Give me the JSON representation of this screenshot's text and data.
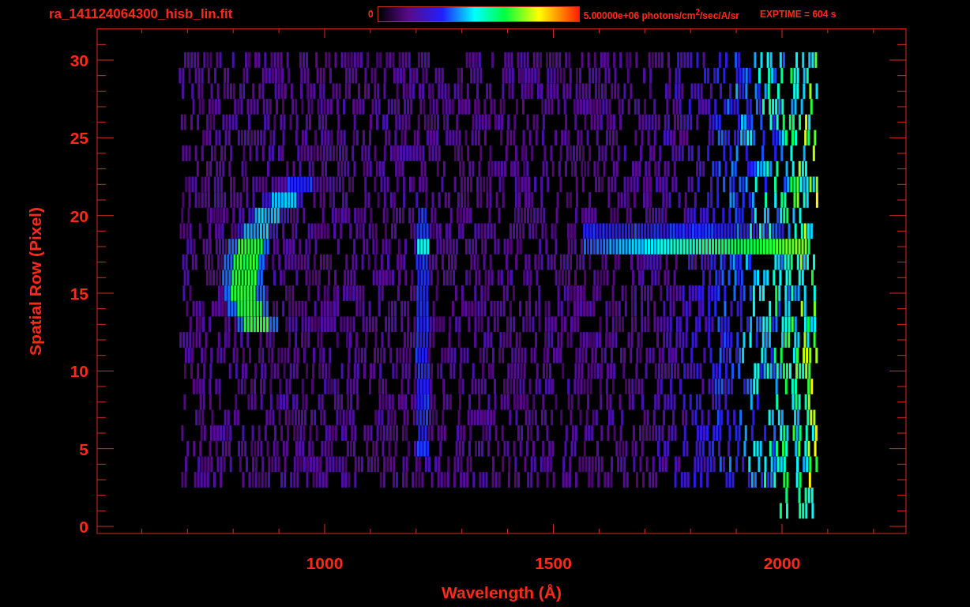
{
  "title": "ra_141124064300_hisb_lin.fit",
  "colorbar": {
    "min_label": "0",
    "max_label": "5.00000e+06 photons/cm$^{2}$/sec/A/sr"
  },
  "exposure": "EXPTIME = 604 s",
  "plot": {
    "x_axis": {
      "title": "Wavelength (Å)",
      "tick_labels": [
        "1000",
        "1500",
        "2000"
      ]
    },
    "y_axis": {
      "title": "Spatial Row (Pixel)",
      "tick_labels": [
        "30",
        "25",
        "20",
        "15",
        "10",
        "5",
        "0"
      ]
    }
  }
}
